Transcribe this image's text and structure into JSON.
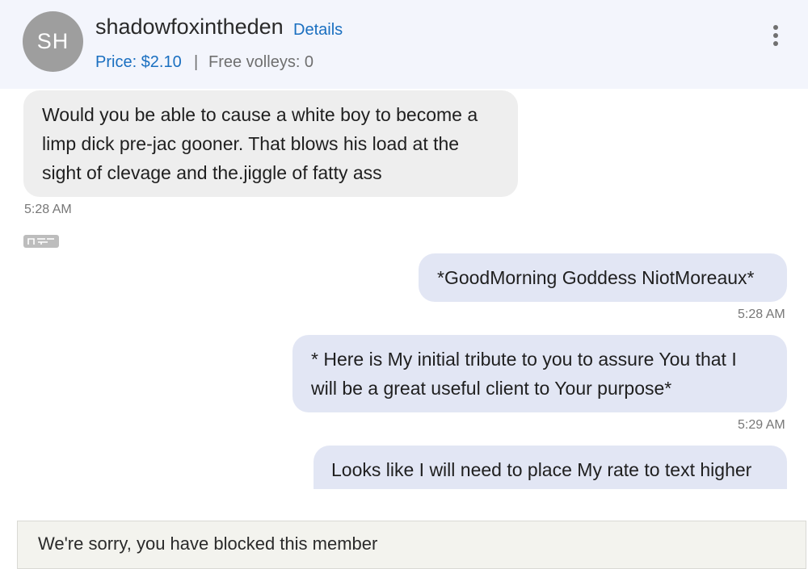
{
  "header": {
    "avatar_initials": "SH",
    "username": "shadowfoxintheden",
    "details_label": "Details",
    "price": "Price: $2.10",
    "separator": "|",
    "free_volleys": "Free volleys: 0"
  },
  "messages": [
    {
      "direction": "incoming",
      "text": "Would you be able to cause a white boy to become a limp dick pre-jac gooner. That blows his load at the sight of clevage and the.jiggle of fatty ass",
      "time": "5:28 AM"
    },
    {
      "direction": "outgoing",
      "text": "*GoodMorning Goddess NiotMoreaux*",
      "time": "5:28 AM"
    },
    {
      "direction": "outgoing",
      "text": "* Here is My initial tribute to you to assure You that I will be a great useful client to Your purpose*",
      "time": "5:29 AM"
    },
    {
      "direction": "outgoing",
      "text": "Looks like I will need to place My rate to text higher",
      "time": ""
    }
  ],
  "badge": {
    "icon": "nf-badge-icon"
  },
  "footer": {
    "blocked_text": "We're sorry, you have blocked this member"
  },
  "colors": {
    "accent": "#1a6fc0",
    "header_bg": "#f3f5fc",
    "incoming_bubble": "#eeeeee",
    "outgoing_bubble": "#e2e6f4",
    "avatar_bg": "#9e9e9e"
  }
}
